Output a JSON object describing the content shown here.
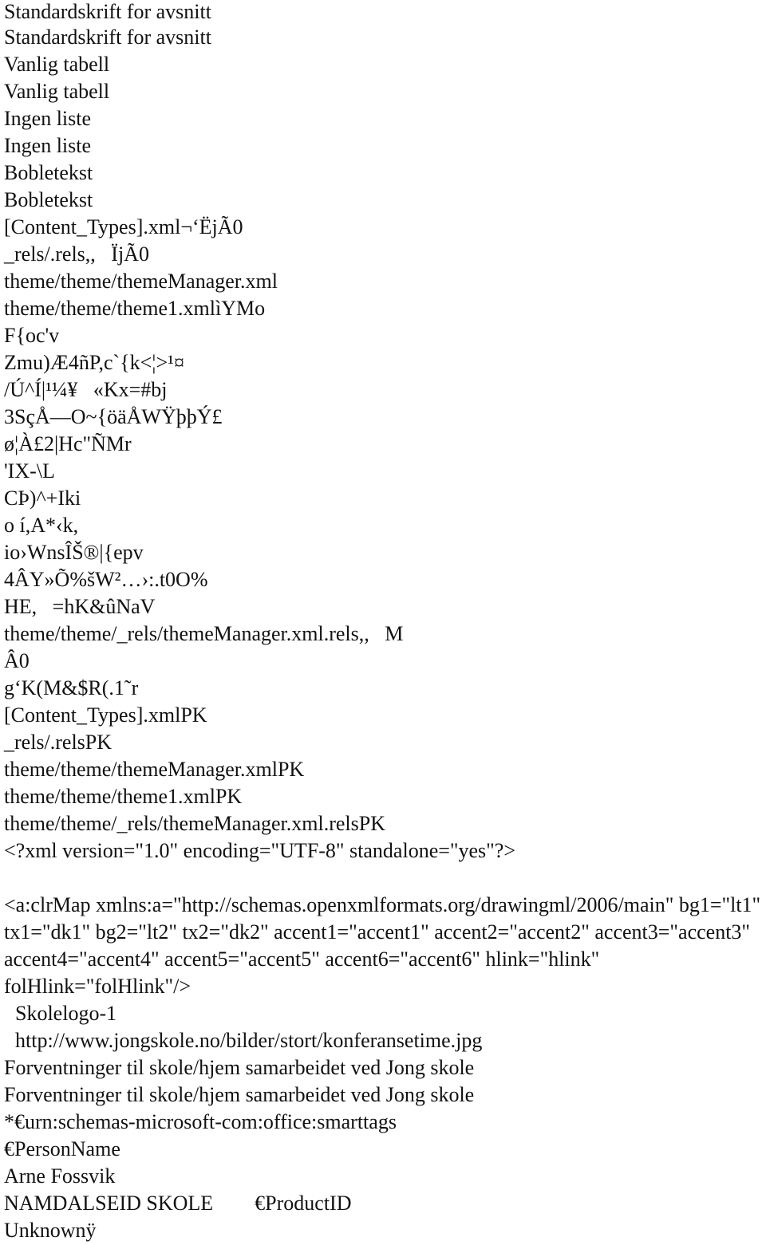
{
  "document": {
    "lines_block1": [
      "Standardskrift for avsnitt",
      "Standardskrift for avsnitt",
      "Vanlig tabell",
      "Vanlig tabell",
      "Ingen liste",
      "Ingen liste",
      "Bobletekst",
      "Bobletekst",
      "[Content_Types].xml¬‘ËjÃ0",
      "_rels/.rels,,   ÏjÃ0",
      "theme/theme/themeManager.xml",
      "theme/theme/theme1.xmlìYMo",
      "F{oc'v",
      "Zmu)Æ4ñP,c`{k<¦>¹¤",
      "/Ú^Í|¹¼¥   «Kx=#bj",
      "3SçÅ—O~{öäÅWŸþþÝ£",
      "ø¦À£2|Hc\"ÑMr",
      "'IX-\\L",
      "CÞ)^+Iki",
      "o í,A*‹k,",
      "io›WnsÎŠ®|{epv",
      "4ÂY»Õ%šW²…›:.t0O%",
      "HE,   =hK&ûNaV",
      "theme/theme/_rels/themeManager.xml.rels,,   M",
      "Â0",
      "g‘K(M&$R(.1˜r",
      "[Content_Types].xmlPK",
      "_rels/.relsPK",
      "theme/theme/themeManager.xmlPK",
      "theme/theme/theme1.xmlPK",
      "theme/theme/_rels/themeManager.xml.relsPK",
      "<?xml version=\"1.0\" encoding=\"UTF-8\" standalone=\"yes\"?>"
    ],
    "clrmap_paragraph": "<a:clrMap xmlns:a=\"http://schemas.openxmlformats.org/drawingml/2006/main\" bg1=\"lt1\" tx1=\"dk1\" bg2=\"lt2\" tx2=\"dk2\" accent1=\"accent1\" accent2=\"accent2\" accent3=\"accent3\" accent4=\"accent4\" accent5=\"accent5\" accent6=\"accent6\" hlink=\"hlink\" folHlink=\"folHlink\"/>",
    "logo_name": "Skolelogo-1",
    "image_url": "http://www.jongskole.no/bilder/stort/konferansetime.jpg",
    "title_1": "Forventninger til skole/hjem samarbeidet ved Jong skole",
    "title_2": "Forventninger til skole/hjem samarbeidet ved Jong skole",
    "smarttags": "*€urn:schemas-microsoft-com:office:smarttags",
    "person_name_tag": "€PersonName",
    "author": "Arne Fossvik",
    "school": "NAMDALSEID SKOLE",
    "product_id_tag": "€ProductID",
    "unknown": "Unknownÿ"
  }
}
